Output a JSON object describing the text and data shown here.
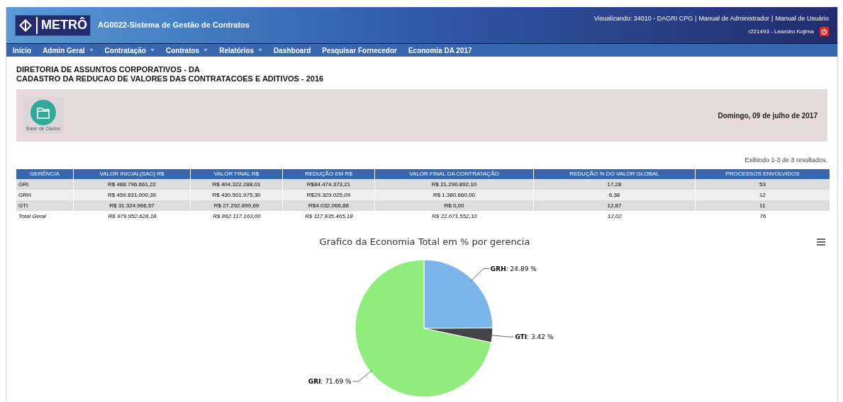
{
  "header": {
    "logo": "METRÔ",
    "system_title": "AG0022-Sistema de Gestão de Contratos",
    "viewing": "Visualizando: 34010 - DAGRI CPG",
    "separator": "|",
    "links": [
      "Manual de Administrador",
      "Manual de Usuário"
    ],
    "user": "r221493 - Leandro Kojima"
  },
  "nav": [
    {
      "label": "Início",
      "dropdown": false
    },
    {
      "label": "Admin Geral",
      "dropdown": true
    },
    {
      "label": "Contratação",
      "dropdown": true
    },
    {
      "label": "Contratos",
      "dropdown": true
    },
    {
      "label": "Relatórios",
      "dropdown": true
    },
    {
      "label": "Dashboard",
      "dropdown": false
    },
    {
      "label": "Pesquisar Fornecedor",
      "dropdown": false
    },
    {
      "label": "Economia DA 2017",
      "dropdown": false
    }
  ],
  "titles": [
    "DIRETORIA DE ASSUNTOS CORPORATIVOS - DA",
    "CADASTRO DA REDUCAO DE VALORES DAS CONTRATACOES E ADITIVOS - 2016"
  ],
  "banner": {
    "shortcut": "Base de Dados",
    "date": "Domingo, 09 de julho de 2017"
  },
  "summary": "Exibindo 1-3 de 3 resultados.",
  "table": {
    "columns": [
      "GERÊNCIA",
      "VALOR INICIAL(SAC) R$",
      "VALOR FINAL R$",
      "REDUÇÃO EM R$",
      "VALOR FINAL DA CONTRATAÇÃO",
      "REDUÇÃO % DO VALOR GLOBAL",
      "PROCESSOS ENVOLVIDOS"
    ],
    "rows": [
      [
        "GRI",
        "R$ 488.796.661,22",
        "R$ 404.322.288,01",
        "R$84.474.373,21",
        "R$ 21.290.892,10",
        "17,28",
        "53"
      ],
      [
        "GRH",
        "R$ 459.831.000,39",
        "R$ 430.501.975,30",
        "R$29.329.025,09",
        "R$ 1.380.660,00",
        "6,38",
        "12"
      ],
      [
        "GTI",
        "R$ 31.324.966,57",
        "R$ 27.292.899,69",
        "R$4.032.066,88",
        "R$ 0,00",
        "12,87",
        "11"
      ]
    ],
    "total": [
      "Total Geral",
      "R$ 979.952.628,18",
      "R$ 862.117.163,00",
      "R$ 117.835.465,18",
      "R$ 22.671.552,10",
      "12,02",
      "76"
    ]
  },
  "chart": {
    "chart_data": {
      "type": "pie",
      "title": "Grafico da Economia Total em % por gerencia",
      "categories": [
        "GRH",
        "GTI",
        "GRI"
      ],
      "values": [
        24.89,
        3.42,
        71.69
      ],
      "value_labels": [
        ": 24.89 %",
        ": 3.42 %",
        ": 71.69 %"
      ]
    }
  }
}
